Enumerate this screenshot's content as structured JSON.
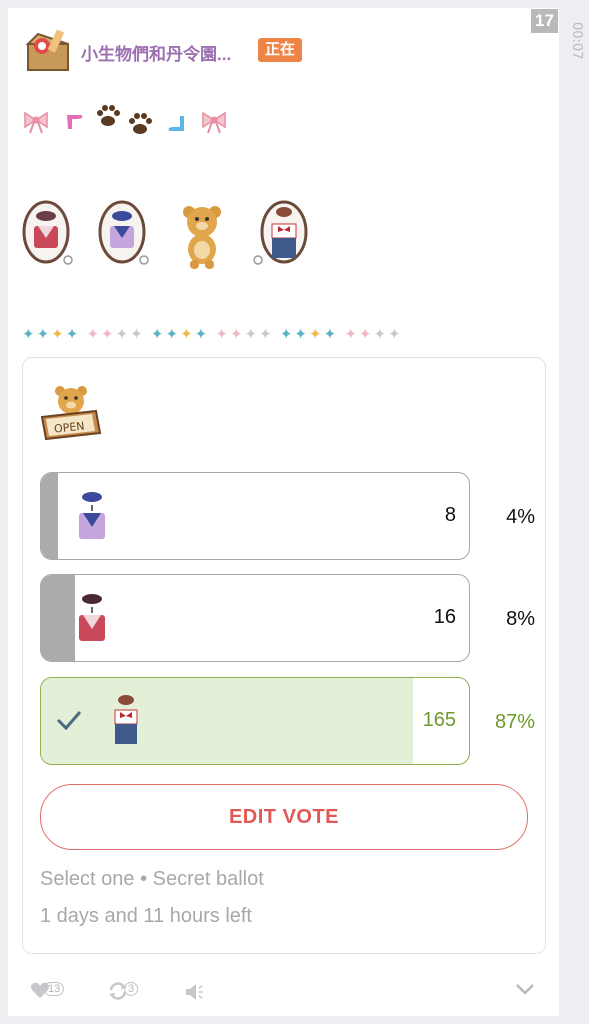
{
  "post": {
    "index_badge": "17",
    "side_time": "00:07",
    "channel_name": "小生物們和丹令園...",
    "status_badge": "正在",
    "sparkle_line": "✦✦✦✦ ✦✦✦✦ ✦✦✦✦ ✦✦✦✦ ✦✦✦✦ ✦✦✦✦"
  },
  "emoji_row": [
    "bow-icon",
    "boomerang-pink-icon",
    "paw-icon",
    "paw-icon",
    "boomerang-blue-icon",
    "bow-icon"
  ],
  "sticker_row": [
    "red-sailor-outfit-mirror",
    "purple-sailor-outfit-mirror",
    "teddy-bear",
    "overalls-outfit-mirror"
  ],
  "poll": {
    "sticker": "bear-open-sign",
    "options": [
      {
        "thumb": "purple-sailor-outfit",
        "count": "8",
        "percent": "4%",
        "fraction": 0.04,
        "selected": false
      },
      {
        "thumb": "red-sailor-outfit",
        "count": "16",
        "percent": "8%",
        "fraction": 0.08,
        "selected": false
      },
      {
        "thumb": "overalls-outfit",
        "count": "165",
        "percent": "87%",
        "fraction": 0.87,
        "selected": true
      }
    ],
    "edit_label": "EDIT VOTE",
    "meta_type": "Select one • Secret ballot",
    "meta_time": "1 days and 11 hours left"
  },
  "footer": {
    "likes": "13",
    "reposts": "3"
  },
  "colors": {
    "accent_red": "#df5a57",
    "selected_green": "#6d9a2a",
    "channel_purple": "#9b6fb0",
    "badge_orange": "#ee8446"
  }
}
